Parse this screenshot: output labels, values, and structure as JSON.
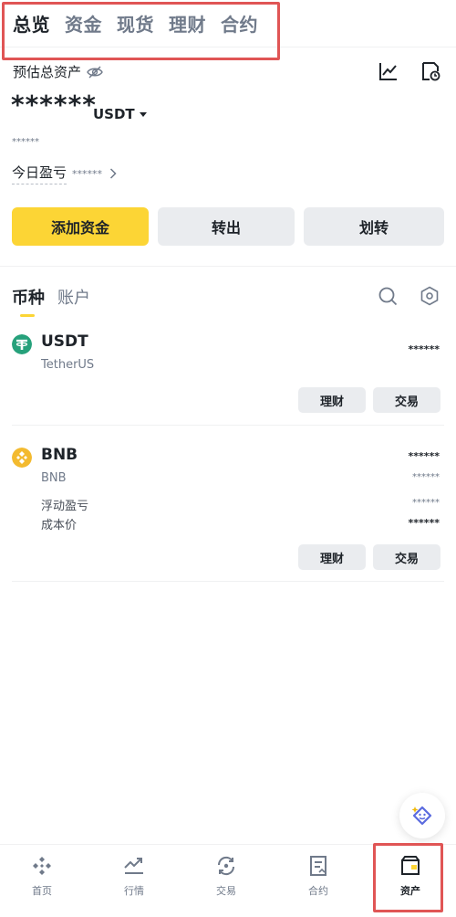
{
  "top_tabs": [
    "总览",
    "资金",
    "现货",
    "理财",
    "合约"
  ],
  "header": {
    "label": "预估总资产",
    "balance": "******",
    "currency": "USDT"
  },
  "small_mask": "******",
  "pnl": {
    "label": "今日盈亏",
    "value": "******"
  },
  "actions": {
    "deposit": "添加资金",
    "withdraw": "转出",
    "transfer": "划转"
  },
  "sub_tabs": [
    "币种",
    "账户"
  ],
  "coins": [
    {
      "symbol": "USDT",
      "name": "TetherUS",
      "value": "******",
      "buttons": [
        "理财",
        "交易"
      ],
      "color": "#26a17b"
    },
    {
      "symbol": "BNB",
      "name": "BNB",
      "value": "******",
      "value_sub": "******",
      "float_pnl_label": "浮动盈亏",
      "float_pnl_value": "******",
      "cost_label": "成本价",
      "cost_value": "******",
      "buttons": [
        "理财",
        "交易"
      ],
      "color": "#f3ba2f"
    }
  ],
  "nav": [
    {
      "label": "首页",
      "icon": "home-icon"
    },
    {
      "label": "行情",
      "icon": "markets-icon"
    },
    {
      "label": "交易",
      "icon": "trade-icon"
    },
    {
      "label": "合约",
      "icon": "futures-icon"
    },
    {
      "label": "资产",
      "icon": "wallet-icon"
    }
  ],
  "colors": {
    "accent": "#fcd535",
    "highlight": "#e05555"
  }
}
